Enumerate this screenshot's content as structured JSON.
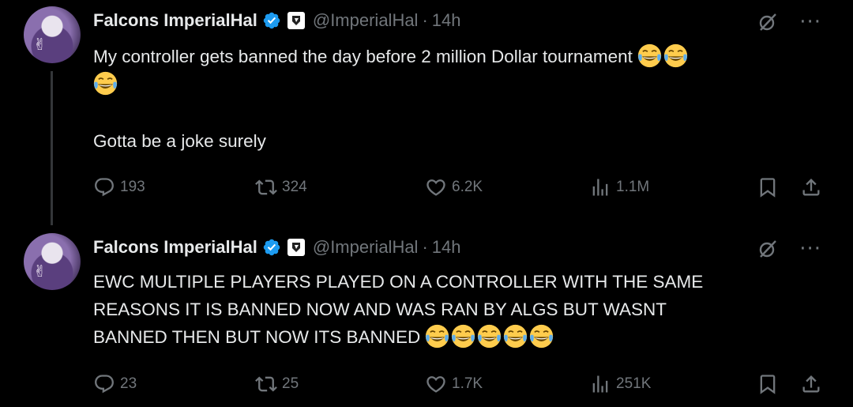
{
  "tweets": [
    {
      "author": {
        "name": "Falcons ImperialHal",
        "handle": "@ImperialHal",
        "time": "14h"
      },
      "text_lines": [
        "My controller gets banned the day before 2 million Dollar tournament"
      ],
      "text_second": "Gotta be a joke surely",
      "emoji_count": 3,
      "stats": {
        "replies": "193",
        "reposts": "324",
        "likes": "6.2K",
        "views": "1.1M"
      }
    },
    {
      "author": {
        "name": "Falcons ImperialHal",
        "handle": "@ImperialHal",
        "time": "14h"
      },
      "text_lines": [
        "EWC MULTIPLE PLAYERS PLAYED ON A CONTROLLER WITH THE SAME",
        "REASONS IT IS BANNED NOW AND WAS RAN BY ALGS BUT WASNT",
        "BANNED THEN BUT NOW ITS BANNED"
      ],
      "emoji_count": 5,
      "stats": {
        "replies": "23",
        "reposts": "25",
        "likes": "1.7K",
        "views": "251K"
      }
    }
  ],
  "separator": "·",
  "more_glyph": "···",
  "colors": {
    "background": "#000000",
    "text": "#e7e9ea",
    "muted": "#71767b",
    "verified": "#1d9bf0",
    "thread_line": "#333639"
  }
}
